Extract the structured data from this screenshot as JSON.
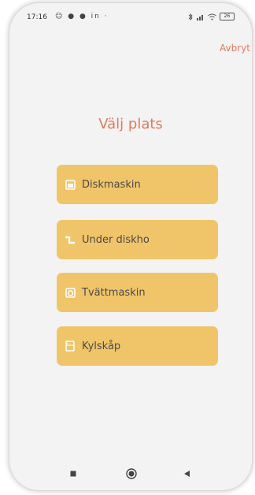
{
  "status_bar": {
    "time": "17:16",
    "left_icons": "☺ ● ● in ·",
    "battery": "26"
  },
  "header": {
    "cancel_label": "Avbryt"
  },
  "main": {
    "title": "Välj plats",
    "options": [
      {
        "label": "Diskmaskin",
        "icon": "dishwasher-icon"
      },
      {
        "label": "Under diskho",
        "icon": "pipe-icon"
      },
      {
        "label": "Tvättmaskin",
        "icon": "washing-machine-icon"
      },
      {
        "label": "Kylskåp",
        "icon": "fridge-icon"
      }
    ]
  },
  "colors": {
    "accent": "#e07a5f",
    "option_bg": "#f0c569",
    "background": "#f3f3f3"
  }
}
